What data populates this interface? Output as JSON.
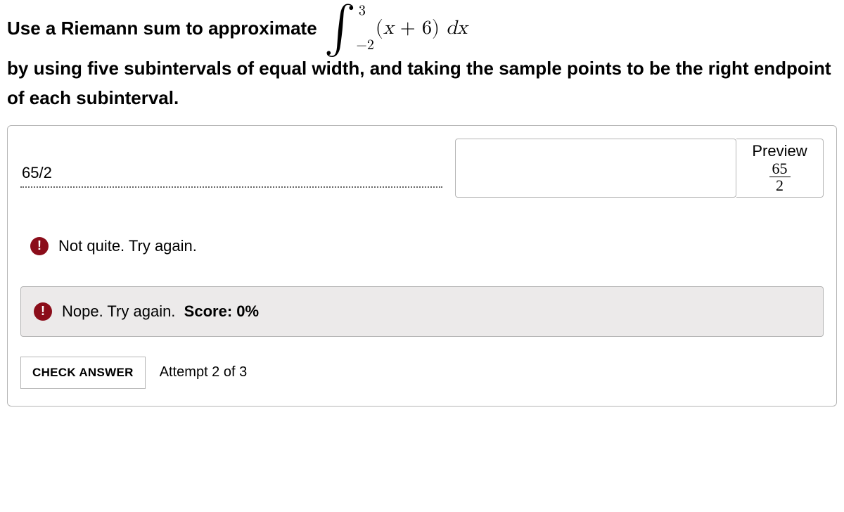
{
  "question": {
    "prefix": "Use a Riemann sum to approximate",
    "integral": {
      "lower": "−2",
      "upper": "3",
      "integrand_var": "x",
      "integrand_plus": "+",
      "integrand_const": "6",
      "dx": "dx"
    },
    "suffix": "by using five subintervals of equal width, and taking the sample points to be the right endpoint of each subinterval."
  },
  "answer": {
    "value": "65/2"
  },
  "preview": {
    "label": "Preview",
    "numerator": "65",
    "denominator": "2"
  },
  "feedback1": {
    "icon": "!",
    "text": "Not quite. Try again."
  },
  "feedback2": {
    "icon": "!",
    "text": "Nope. Try again.",
    "score_label": "Score:",
    "score_value": "0%"
  },
  "actions": {
    "check_label": "CHECK ANSWER",
    "attempt_text": "Attempt 2 of 3"
  }
}
